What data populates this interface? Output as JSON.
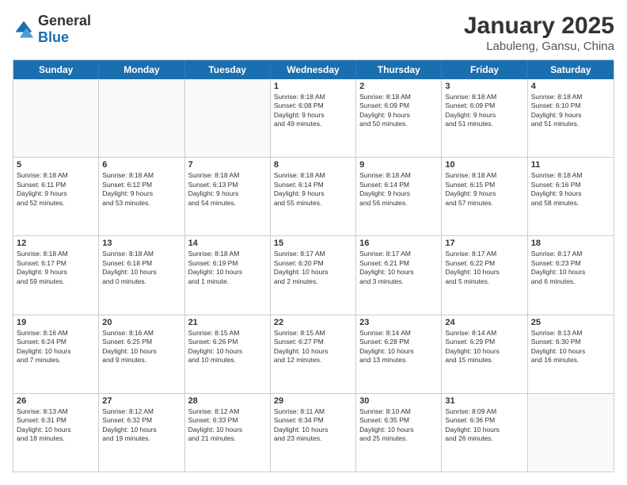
{
  "logo": {
    "general": "General",
    "blue": "Blue"
  },
  "title": "January 2025",
  "subtitle": "Labuleng, Gansu, China",
  "header_days": [
    "Sunday",
    "Monday",
    "Tuesday",
    "Wednesday",
    "Thursday",
    "Friday",
    "Saturday"
  ],
  "weeks": [
    [
      {
        "day": "",
        "info": ""
      },
      {
        "day": "",
        "info": ""
      },
      {
        "day": "",
        "info": ""
      },
      {
        "day": "1",
        "info": "Sunrise: 8:18 AM\nSunset: 6:08 PM\nDaylight: 9 hours\nand 49 minutes."
      },
      {
        "day": "2",
        "info": "Sunrise: 8:18 AM\nSunset: 6:09 PM\nDaylight: 9 hours\nand 50 minutes."
      },
      {
        "day": "3",
        "info": "Sunrise: 8:18 AM\nSunset: 6:09 PM\nDaylight: 9 hours\nand 51 minutes."
      },
      {
        "day": "4",
        "info": "Sunrise: 8:18 AM\nSunset: 6:10 PM\nDaylight: 9 hours\nand 51 minutes."
      }
    ],
    [
      {
        "day": "5",
        "info": "Sunrise: 8:18 AM\nSunset: 6:11 PM\nDaylight: 9 hours\nand 52 minutes."
      },
      {
        "day": "6",
        "info": "Sunrise: 8:18 AM\nSunset: 6:12 PM\nDaylight: 9 hours\nand 53 minutes."
      },
      {
        "day": "7",
        "info": "Sunrise: 8:18 AM\nSunset: 6:13 PM\nDaylight: 9 hours\nand 54 minutes."
      },
      {
        "day": "8",
        "info": "Sunrise: 8:18 AM\nSunset: 6:14 PM\nDaylight: 9 hours\nand 55 minutes."
      },
      {
        "day": "9",
        "info": "Sunrise: 8:18 AM\nSunset: 6:14 PM\nDaylight: 9 hours\nand 56 minutes."
      },
      {
        "day": "10",
        "info": "Sunrise: 8:18 AM\nSunset: 6:15 PM\nDaylight: 9 hours\nand 57 minutes."
      },
      {
        "day": "11",
        "info": "Sunrise: 8:18 AM\nSunset: 6:16 PM\nDaylight: 9 hours\nand 58 minutes."
      }
    ],
    [
      {
        "day": "12",
        "info": "Sunrise: 8:18 AM\nSunset: 6:17 PM\nDaylight: 9 hours\nand 59 minutes."
      },
      {
        "day": "13",
        "info": "Sunrise: 8:18 AM\nSunset: 6:18 PM\nDaylight: 10 hours\nand 0 minutes."
      },
      {
        "day": "14",
        "info": "Sunrise: 8:18 AM\nSunset: 6:19 PM\nDaylight: 10 hours\nand 1 minute."
      },
      {
        "day": "15",
        "info": "Sunrise: 8:17 AM\nSunset: 6:20 PM\nDaylight: 10 hours\nand 2 minutes."
      },
      {
        "day": "16",
        "info": "Sunrise: 8:17 AM\nSunset: 6:21 PM\nDaylight: 10 hours\nand 3 minutes."
      },
      {
        "day": "17",
        "info": "Sunrise: 8:17 AM\nSunset: 6:22 PM\nDaylight: 10 hours\nand 5 minutes."
      },
      {
        "day": "18",
        "info": "Sunrise: 8:17 AM\nSunset: 6:23 PM\nDaylight: 10 hours\nand 6 minutes."
      }
    ],
    [
      {
        "day": "19",
        "info": "Sunrise: 8:16 AM\nSunset: 6:24 PM\nDaylight: 10 hours\nand 7 minutes."
      },
      {
        "day": "20",
        "info": "Sunrise: 8:16 AM\nSunset: 6:25 PM\nDaylight: 10 hours\nand 9 minutes."
      },
      {
        "day": "21",
        "info": "Sunrise: 8:15 AM\nSunset: 6:26 PM\nDaylight: 10 hours\nand 10 minutes."
      },
      {
        "day": "22",
        "info": "Sunrise: 8:15 AM\nSunset: 6:27 PM\nDaylight: 10 hours\nand 12 minutes."
      },
      {
        "day": "23",
        "info": "Sunrise: 8:14 AM\nSunset: 6:28 PM\nDaylight: 10 hours\nand 13 minutes."
      },
      {
        "day": "24",
        "info": "Sunrise: 8:14 AM\nSunset: 6:29 PM\nDaylight: 10 hours\nand 15 minutes."
      },
      {
        "day": "25",
        "info": "Sunrise: 8:13 AM\nSunset: 6:30 PM\nDaylight: 10 hours\nand 16 minutes."
      }
    ],
    [
      {
        "day": "26",
        "info": "Sunrise: 8:13 AM\nSunset: 6:31 PM\nDaylight: 10 hours\nand 18 minutes."
      },
      {
        "day": "27",
        "info": "Sunrise: 8:12 AM\nSunset: 6:32 PM\nDaylight: 10 hours\nand 19 minutes."
      },
      {
        "day": "28",
        "info": "Sunrise: 8:12 AM\nSunset: 6:33 PM\nDaylight: 10 hours\nand 21 minutes."
      },
      {
        "day": "29",
        "info": "Sunrise: 8:11 AM\nSunset: 6:34 PM\nDaylight: 10 hours\nand 23 minutes."
      },
      {
        "day": "30",
        "info": "Sunrise: 8:10 AM\nSunset: 6:35 PM\nDaylight: 10 hours\nand 25 minutes."
      },
      {
        "day": "31",
        "info": "Sunrise: 8:09 AM\nSunset: 6:36 PM\nDaylight: 10 hours\nand 26 minutes."
      },
      {
        "day": "",
        "info": ""
      }
    ]
  ]
}
